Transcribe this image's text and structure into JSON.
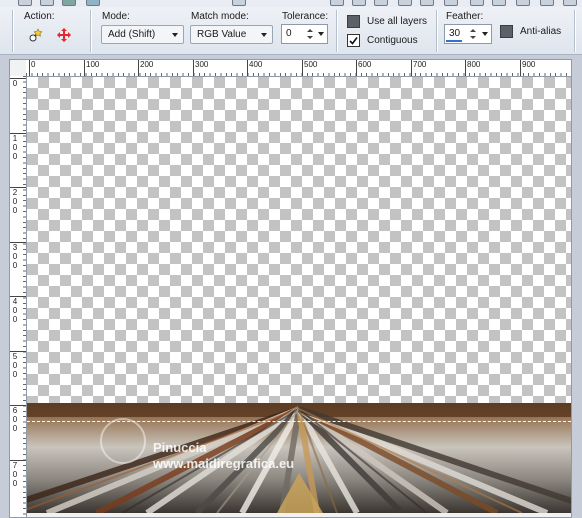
{
  "toolbar": {
    "action_label": "Action:",
    "mode_label": "Mode:",
    "mode_value": "Add (Shift)",
    "match_mode_label": "Match mode:",
    "match_mode_value": "RGB Value",
    "tolerance_label": "Tolerance:",
    "tolerance_value": "0",
    "use_all_layers_label": "Use all layers",
    "use_all_layers_checked": false,
    "contiguous_label": "Contiguous",
    "contiguous_checked": true,
    "feather_label": "Feather:",
    "feather_value": "30",
    "anti_alias_label": "Anti-alias",
    "anti_alias_checked": false
  },
  "rulers": {
    "horizontal_labels": [
      "0",
      "100",
      "200",
      "300",
      "400",
      "500",
      "600",
      "700",
      "800",
      "900"
    ],
    "vertical_labels": [
      "0",
      "100",
      "200",
      "300",
      "400",
      "500",
      "600",
      "700"
    ]
  },
  "watermark": {
    "name": "Pinuccia",
    "url": "www.maidiregrafica.eu"
  },
  "icons": {
    "action_add": "magic-wand-add-icon",
    "action_move": "move-cross-icon"
  }
}
